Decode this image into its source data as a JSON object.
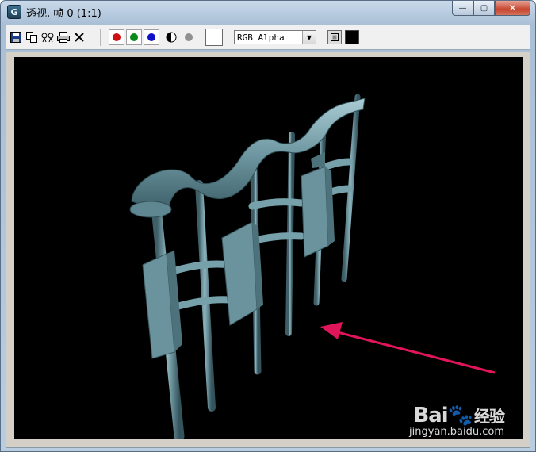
{
  "window": {
    "title": "透视, 帧 0 (1:1)",
    "app_icon": "G",
    "buttons": {
      "minimize": "—",
      "maximize": "▢",
      "close": "✕"
    }
  },
  "toolbar": {
    "icons": [
      "save-icon",
      "copy-icon",
      "clone-icon",
      "print-icon",
      "clear-icon"
    ],
    "channels": [
      {
        "name": "red-channel",
        "color": "#d01010"
      },
      {
        "name": "green-channel",
        "color": "#0a8a1a"
      },
      {
        "name": "blue-channel",
        "color": "#1010c8"
      }
    ],
    "display_mode": "RGB Alpha"
  },
  "watermark": {
    "logo": "Bai",
    "logo_suffix": "经验",
    "url": "jingyan.baidu.com"
  },
  "colors": {
    "viewport_bg": "#000000",
    "model": "#6f9aa4",
    "arrow": "#e0155a"
  }
}
